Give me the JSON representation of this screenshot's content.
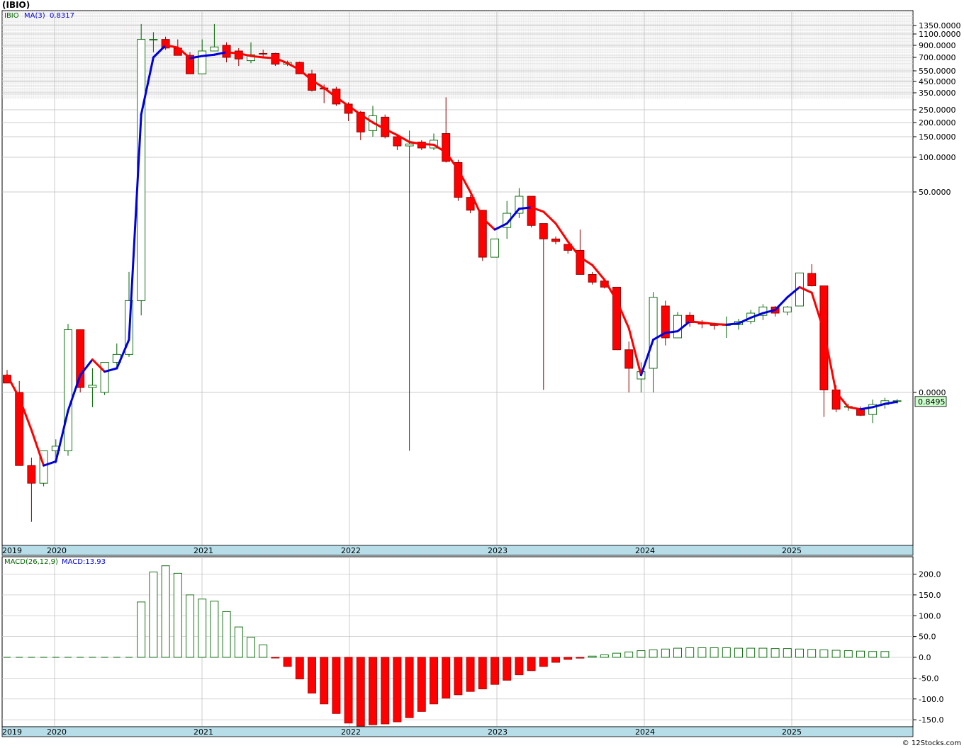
{
  "title": "(IBIO)",
  "credit": "© 12Stocks.com",
  "colors": {
    "up": "#006400",
    "down": "#ff0000",
    "ma_up": "#0000dd",
    "ma_down": "#ff0000",
    "axis_bar": "#b6dde8",
    "price_label_bg": "#ccffcc",
    "grid": "#c8c8c8"
  },
  "chart_data": [
    {
      "type": "candlestick",
      "panel": "price",
      "legend": {
        "symbol": "IBIO",
        "ma_label": "MA(3)",
        "ma_value": "0.8317"
      },
      "scale": "log",
      "last_price_label": "0.8495",
      "y_tick_labels": [
        "1350.0000",
        "1100.0000",
        "900.0000",
        "700.0000",
        "550.0000",
        "450.0000",
        "350.0000",
        "250.0000",
        "200.0000",
        "150.0000",
        "100.0000",
        "50.0000",
        "0.0000"
      ],
      "y_tick_values": [
        1350,
        1100,
        900,
        700,
        550,
        450,
        350,
        250,
        200,
        150,
        100,
        50,
        1
      ],
      "x_labels": [
        "2019",
        "2020",
        "2021",
        "2022",
        "2023",
        "2024",
        "2025"
      ],
      "candles": [
        {
          "o": 1.4,
          "h": 1.55,
          "l": 1.2,
          "c": 1.2
        },
        {
          "o": 1.0,
          "h": 1.25,
          "l": 0.26,
          "c": 0.24
        },
        {
          "o": 0.24,
          "h": 0.28,
          "l": 0.08,
          "c": 0.17
        },
        {
          "o": 0.17,
          "h": 0.32,
          "l": 0.16,
          "c": 0.32
        },
        {
          "o": 0.32,
          "h": 0.4,
          "l": 0.25,
          "c": 0.35
        },
        {
          "o": 0.32,
          "h": 3.8,
          "l": 0.29,
          "c": 3.4
        },
        {
          "o": 3.4,
          "h": 3.4,
          "l": 1.0,
          "c": 1.1
        },
        {
          "o": 1.1,
          "h": 1.6,
          "l": 0.75,
          "c": 1.15
        },
        {
          "o": 1.0,
          "h": 1.8,
          "l": 0.95,
          "c": 1.8
        },
        {
          "o": 1.8,
          "h": 2.6,
          "l": 1.6,
          "c": 2.1
        },
        {
          "o": 2.1,
          "h": 10.5,
          "l": 2.0,
          "c": 6.0
        },
        {
          "o": 6.0,
          "h": 1400,
          "l": 4.5,
          "c": 1000
        },
        {
          "o": 1000,
          "h": 1150,
          "l": 780,
          "c": 1000
        },
        {
          "o": 1000,
          "h": 1050,
          "l": 820,
          "c": 850
        },
        {
          "o": 850,
          "h": 1000,
          "l": 730,
          "c": 730
        },
        {
          "o": 730,
          "h": 780,
          "l": 520,
          "c": 520
        },
        {
          "o": 520,
          "h": 1000,
          "l": 520,
          "c": 800
        },
        {
          "o": 800,
          "h": 1400,
          "l": 800,
          "c": 870
        },
        {
          "o": 900,
          "h": 950,
          "l": 640,
          "c": 700
        },
        {
          "o": 800,
          "h": 850,
          "l": 600,
          "c": 680
        },
        {
          "o": 660,
          "h": 950,
          "l": 630,
          "c": 740
        },
        {
          "o": 760,
          "h": 820,
          "l": 700,
          "c": 750
        },
        {
          "o": 760,
          "h": 770,
          "l": 600,
          "c": 620
        },
        {
          "o": 620,
          "h": 660,
          "l": 600,
          "c": 640
        },
        {
          "o": 640,
          "h": 650,
          "l": 520,
          "c": 520
        },
        {
          "o": 520,
          "h": 560,
          "l": 360,
          "c": 370
        },
        {
          "o": 390,
          "h": 420,
          "l": 285,
          "c": 380
        },
        {
          "o": 380,
          "h": 400,
          "l": 270,
          "c": 280
        },
        {
          "o": 280,
          "h": 290,
          "l": 205,
          "c": 235
        },
        {
          "o": 240,
          "h": 245,
          "l": 140,
          "c": 165
        },
        {
          "o": 170,
          "h": 270,
          "l": 150,
          "c": 225
        },
        {
          "o": 220,
          "h": 230,
          "l": 145,
          "c": 150
        },
        {
          "o": 150,
          "h": 155,
          "l": 115,
          "c": 125
        },
        {
          "o": 125,
          "h": 170,
          "l": 0.32,
          "c": 130
        },
        {
          "o": 135,
          "h": 140,
          "l": 115,
          "c": 120
        },
        {
          "o": 120,
          "h": 160,
          "l": 115,
          "c": 140
        },
        {
          "o": 160,
          "h": 320,
          "l": 90,
          "c": 92
        },
        {
          "o": 90,
          "h": 95,
          "l": 42,
          "c": 45
        },
        {
          "o": 45,
          "h": 47,
          "l": 33,
          "c": 35
        },
        {
          "o": 35,
          "h": 35,
          "l": 13,
          "c": 14
        },
        {
          "o": 14,
          "h": 20,
          "l": 14,
          "c": 20
        },
        {
          "o": 25,
          "h": 42,
          "l": 20,
          "c": 33
        },
        {
          "o": 33,
          "h": 54,
          "l": 30,
          "c": 46
        },
        {
          "o": 46,
          "h": 46,
          "l": 25,
          "c": 26
        },
        {
          "o": 27,
          "h": 27,
          "l": 1.05,
          "c": 20
        },
        {
          "o": 20,
          "h": 21,
          "l": 18,
          "c": 19
        },
        {
          "o": 18,
          "h": 18,
          "l": 15,
          "c": 16
        },
        {
          "o": 16,
          "h": 24,
          "l": 10,
          "c": 10
        },
        {
          "o": 10,
          "h": 10.5,
          "l": 8.2,
          "c": 8.6
        },
        {
          "o": 8.8,
          "h": 9.3,
          "l": 7.6,
          "c": 7.8
        },
        {
          "o": 7.8,
          "h": 7.8,
          "l": 2.6,
          "c": 2.3
        },
        {
          "o": 2.3,
          "h": 2.7,
          "l": 1.0,
          "c": 1.6
        },
        {
          "o": 1.3,
          "h": 1.8,
          "l": 1.0,
          "c": 1.5
        },
        {
          "o": 1.6,
          "h": 7.1,
          "l": 1.0,
          "c": 6.4
        },
        {
          "o": 5.4,
          "h": 6.0,
          "l": 2.5,
          "c": 2.9
        },
        {
          "o": 2.9,
          "h": 4.8,
          "l": 2.9,
          "c": 4.5
        },
        {
          "o": 4.5,
          "h": 4.8,
          "l": 3.6,
          "c": 3.9
        },
        {
          "o": 3.9,
          "h": 4.1,
          "l": 3.5,
          "c": 3.8
        },
        {
          "o": 3.8,
          "h": 3.9,
          "l": 3.4,
          "c": 3.7
        },
        {
          "o": 3.7,
          "h": 4.4,
          "l": 2.9,
          "c": 3.75
        },
        {
          "o": 3.75,
          "h": 4.2,
          "l": 3.4,
          "c": 4.0
        },
        {
          "o": 4.0,
          "h": 5.0,
          "l": 3.8,
          "c": 4.7
        },
        {
          "o": 4.5,
          "h": 5.6,
          "l": 4.1,
          "c": 5.3
        },
        {
          "o": 5.3,
          "h": 5.4,
          "l": 4.4,
          "c": 4.7
        },
        {
          "o": 4.8,
          "h": 5.4,
          "l": 4.5,
          "c": 5.3
        },
        {
          "o": 5.4,
          "h": 10.3,
          "l": 5.4,
          "c": 10.3
        },
        {
          "o": 10.2,
          "h": 12.2,
          "l": 7.9,
          "c": 8.0
        },
        {
          "o": 8.0,
          "h": 8.0,
          "l": 0.62,
          "c": 1.05
        },
        {
          "o": 1.05,
          "h": 1.15,
          "l": 0.68,
          "c": 0.72
        },
        {
          "o": 0.75,
          "h": 0.8,
          "l": 0.7,
          "c": 0.76
        },
        {
          "o": 0.72,
          "h": 0.76,
          "l": 0.63,
          "c": 0.64
        },
        {
          "o": 0.65,
          "h": 0.87,
          "l": 0.55,
          "c": 0.79
        },
        {
          "o": 0.79,
          "h": 0.9,
          "l": 0.73,
          "c": 0.85
        },
        {
          "o": 0.84,
          "h": 0.88,
          "l": 0.8,
          "c": 0.85
        }
      ],
      "ma3": [
        1.4,
        0.9,
        0.48,
        0.24,
        0.26,
        0.7,
        1.4,
        1.9,
        1.5,
        1.6,
        2.8,
        230,
        700,
        900,
        860,
        690,
        720,
        740,
        780,
        760,
        720,
        700,
        690,
        630,
        560,
        460,
        390,
        320,
        270,
        230,
        200,
        175,
        155,
        135,
        130,
        128,
        110,
        78,
        50,
        30,
        24,
        27,
        36,
        37,
        34,
        27,
        19,
        14,
        12,
        9,
        6,
        3.5,
        1.4,
        2.8,
        3.2,
        3.3,
        4.0,
        3.9,
        3.8,
        3.75,
        3.85,
        4.3,
        4.7,
        5.0,
        6.4,
        7.8,
        7.0,
        3.3,
        1.0,
        0.75,
        0.72,
        0.75,
        0.8,
        0.8317
      ]
    },
    {
      "type": "bar",
      "panel": "macd",
      "legend": {
        "label": "MACD(26,12,9)",
        "value_label": "MACD:13.93"
      },
      "y_tick_labels": [
        "200.0",
        "150.0",
        "100.0",
        "50.0",
        "0.0",
        "-50.0",
        "-100.0",
        "-150.0"
      ],
      "y_tick_values": [
        200,
        150,
        100,
        50,
        0,
        -50,
        -100,
        -150
      ],
      "ylim": [
        -165,
        222
      ],
      "x_labels": [
        "2019",
        "2020",
        "2021",
        "2022",
        "2023",
        "2024",
        "2025"
      ],
      "values": [
        0,
        0,
        0,
        0,
        0,
        0,
        0,
        0,
        0,
        0,
        0,
        133,
        205,
        220,
        202,
        150,
        140,
        135,
        110,
        73,
        48,
        30,
        -1,
        -22,
        -52,
        -86,
        -112,
        -135,
        -158,
        -165,
        -162,
        -160,
        -155,
        -145,
        -130,
        -112,
        -98,
        -90,
        -82,
        -76,
        -65,
        -55,
        -42,
        -32,
        -22,
        -12,
        -5,
        -2,
        3,
        6,
        10,
        13,
        16,
        18,
        20,
        22,
        23,
        23,
        23,
        23,
        22,
        22,
        22,
        21,
        21,
        20,
        19,
        18,
        17,
        16,
        15,
        14,
        13.93
      ]
    }
  ]
}
